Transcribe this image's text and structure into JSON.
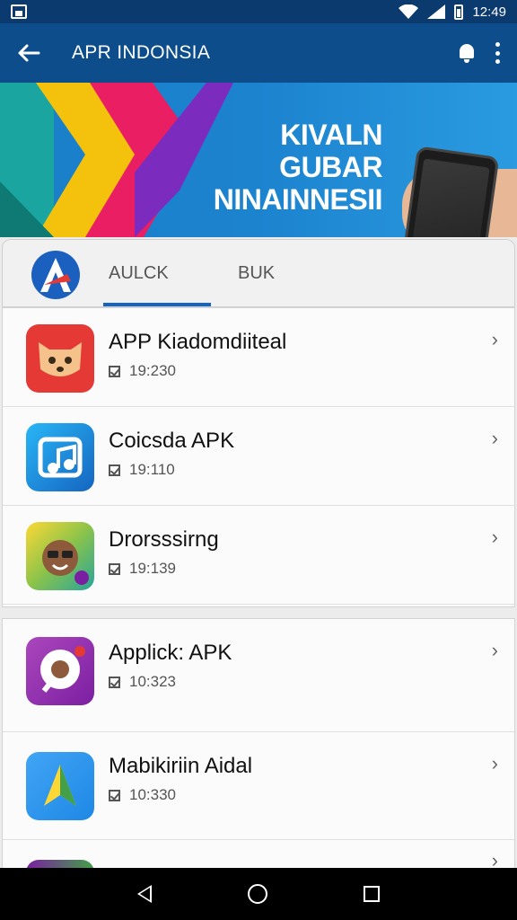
{
  "status_bar": {
    "time": "12:49"
  },
  "app_bar": {
    "title": "APR INDONSIA"
  },
  "banner": {
    "line1": "KIVALN GUBAR",
    "line2": "NINAINNESII"
  },
  "tabs": [
    {
      "label": "AULCK",
      "active": true
    },
    {
      "label": "BUK",
      "active": false
    }
  ],
  "apps": [
    {
      "title": "APP Kiadomdiiteal",
      "meta": "19:230",
      "icon": "fox-app-icon",
      "color": "#e53935"
    },
    {
      "title": "Coicsda APK",
      "meta": "19:110",
      "icon": "music-app-icon",
      "color": "#1e88e5"
    },
    {
      "title": "Drorsssirng",
      "meta": "19:139",
      "icon": "avatar-app-icon",
      "color": "#fbc02d"
    },
    {
      "title": "Applick: APK",
      "meta": "10:323",
      "icon": "chat-app-icon",
      "color": "#9c27b0"
    },
    {
      "title": "Mabikiriin Aidal",
      "meta": "10:330",
      "icon": "map-app-icon",
      "color": "#2196f3"
    }
  ],
  "colors": {
    "app_bar": "#0d4d8b",
    "status_bar": "#0b3a6e",
    "accent": "#1565c0"
  }
}
